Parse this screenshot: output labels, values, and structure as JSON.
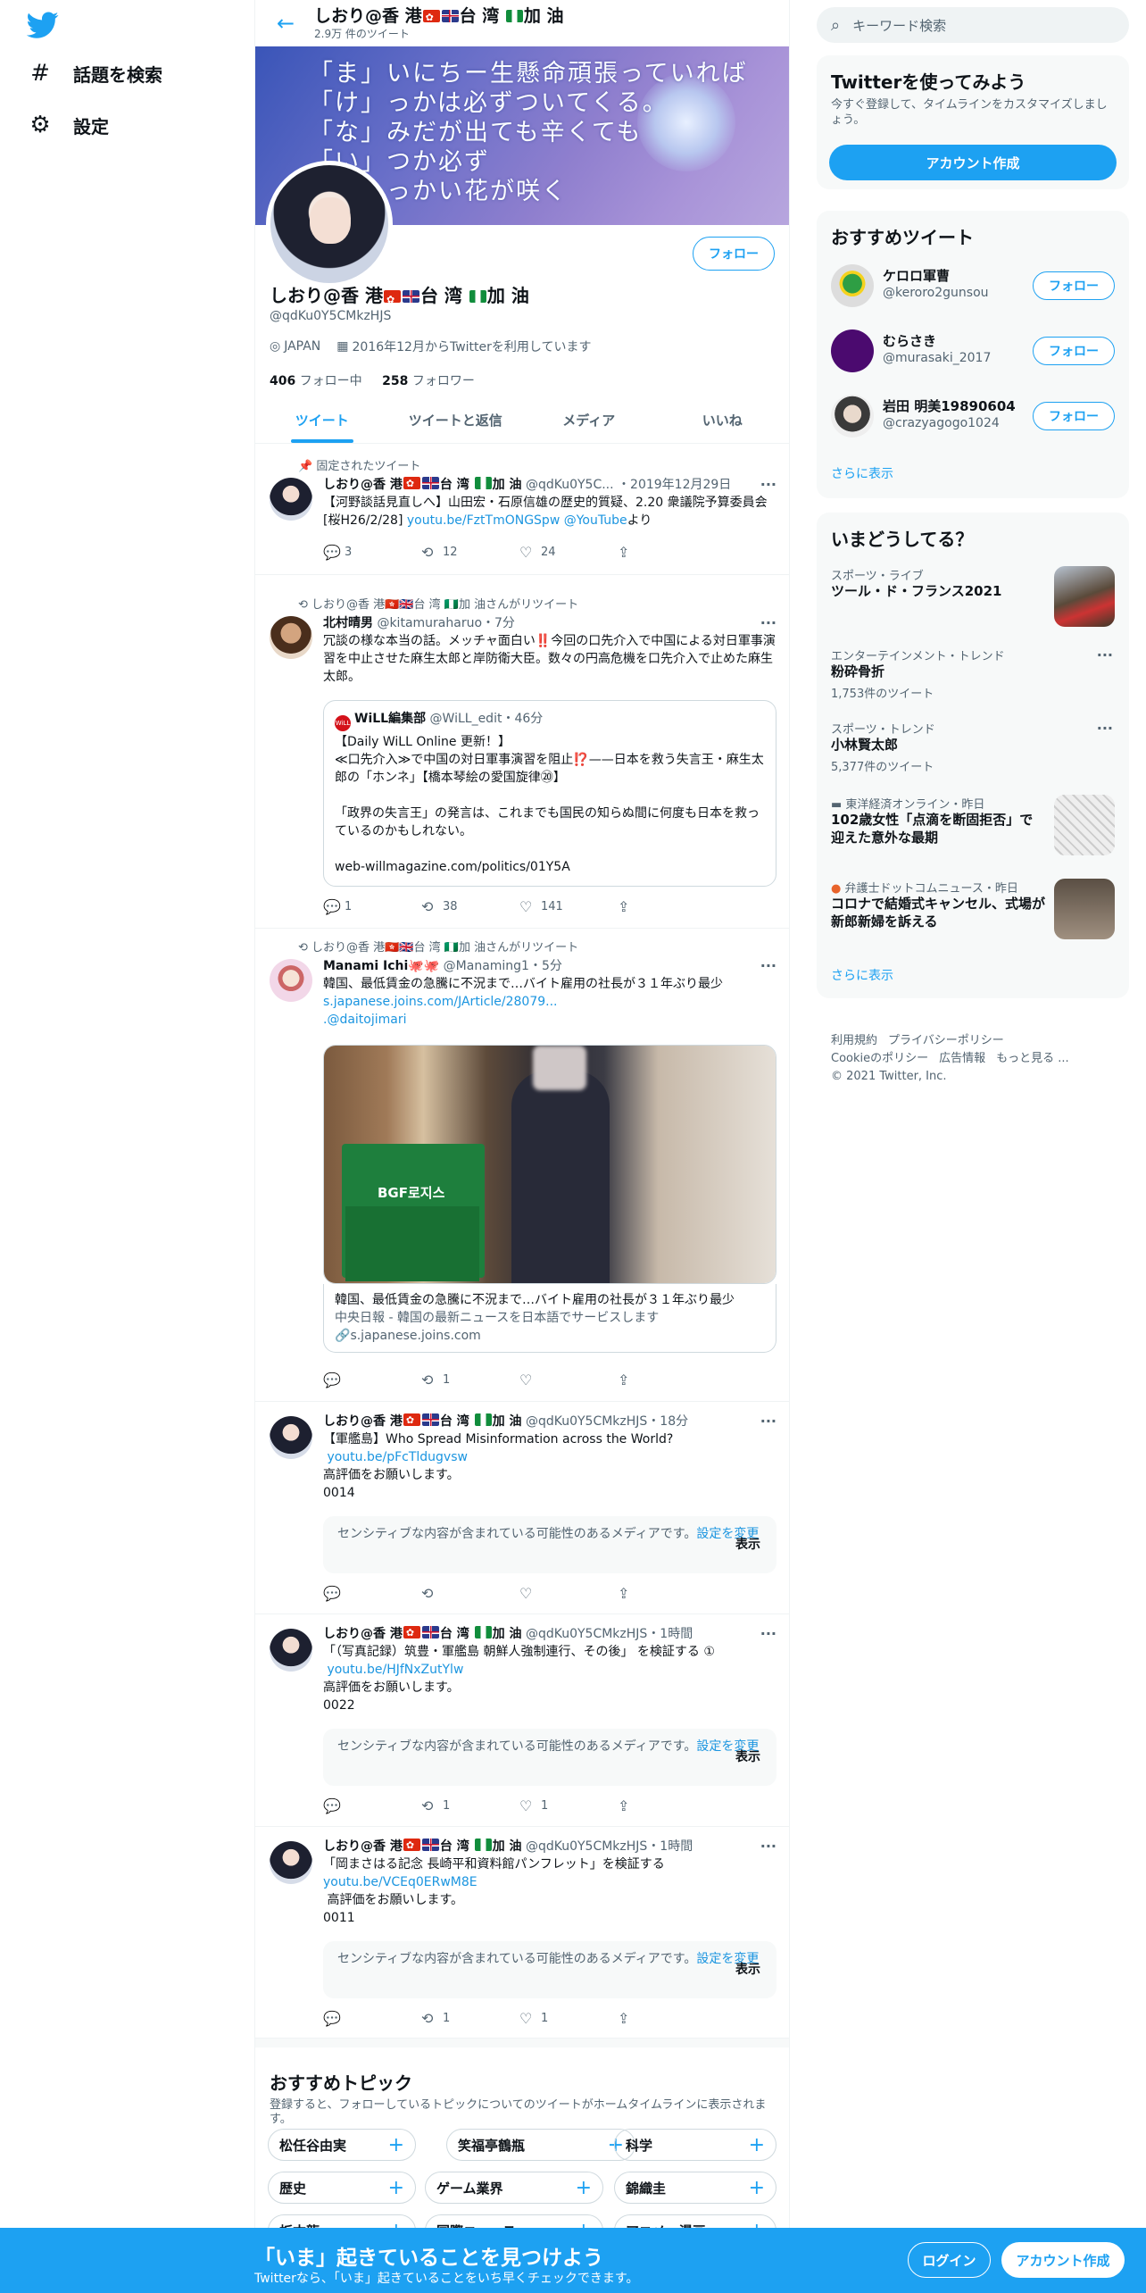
{
  "nav": {
    "items": [
      {
        "label": "話題を検索",
        "icon": "hashtag-icon"
      },
      {
        "label": "設定",
        "icon": "gear-icon"
      }
    ]
  },
  "header": {
    "name": "しおり@香 港🇭🇰🇬🇧台 湾 🇳🇬加 油",
    "count": "2.9万 件のツイート"
  },
  "banner": {
    "poem": "「ま」いにちー生懸命頑張っていれば\n「け」っかは必ずついてくる。\n「な」みだが出ても辛くても\n「い」つか必ず\n「き」っかい花が咲く"
  },
  "profile": {
    "name_pre": "しおり@香 港",
    "name_mid": "台 湾 ",
    "name_post": "加 油",
    "handle": "@qdKu0Y5CMkzHJS",
    "location": "JAPAN",
    "joined": "2016年12月からTwitterを利用しています",
    "following_count": "406",
    "following_label": "フォロー中",
    "followers_count": "258",
    "followers_label": "フォロワー",
    "follow_label": "フォロー"
  },
  "tabs": [
    "ツイート",
    "ツイートと返信",
    "メディア",
    "いいね"
  ],
  "tweets": {
    "t1": {
      "context": "固定されたツイート",
      "name_pre": "しおり@香 港",
      "name_mid": "台 湾 ",
      "name_post": "加 油",
      "handle": "@qdKu0Y5C...",
      "time": "・2019年12月29日",
      "text": "【河野談話見直しへ】山田宏・石原信雄の歴史的質疑、2.20 衆議院予算委員会[桜H26/2/28] ",
      "link1": "youtu.be/FztTmONGSpw",
      "link2": "@YouTube",
      "text_end": "より",
      "replies": "3",
      "retweets": "12",
      "likes": "24"
    },
    "t2": {
      "context": "しおり@香 港🇭🇰🇬🇧台 湾 🇳🇬加 油さんがリツイート",
      "name": "北村晴男",
      "handle": "@kitamuraharuo",
      "time": "・7分",
      "text": "冗談の様な本当の話。メッチャ面白い‼️今回の口先介入で中国による対日軍事演習を中止させた麻生太郎と岸防衛大臣。数々の円高危機を口先介入で止めた麻生太郎。",
      "q_logo": "WiLL",
      "q_name": "WiLL編集部",
      "q_handle": "@WiLL_edit",
      "q_time": "・46分",
      "q_text": "【Daily WiLL Online 更新！】\n≪口先介入≫で中国の対日軍事演習を阻止⁉️——日本を救う失言王・麻生太郎の「ホンネ」【橋本琴絵の愛国旋律⑳】\n\n「政界の失言王」の発言は、これまでも国民の知らぬ間に何度も日本を救っているのかもしれない。\n\nweb-willmagazine.com/politics/01Y5A",
      "replies": "1",
      "retweets": "38",
      "likes": "141"
    },
    "t3": {
      "context": "しおり@香 港🇭🇰🇬🇧台 湾 🇳🇬加 油さんがリツイート",
      "name": "Manami Ichi🐙🐙",
      "handle": "@Manaming1",
      "time": "・5分",
      "text": "韓国、最低賃金の急騰に不況まで…バイト雇用の社長が３１年ぶり最少",
      "link1": "s.japanese.joins.com/JArticle/28079...",
      "link2": ".@daitojimari",
      "crate_label": "BGF로지스",
      "card_title": "韓国、最低賃金の急騰に不況まで…バイト雇用の社長が３１年ぶり最少",
      "card_desc": "中央日報 - 韓国の最新ニュースを日本語でサービスします",
      "card_domain": "s.japanese.joins.com",
      "retweets": "1"
    },
    "t4": {
      "name_pre": "しおり@香 港",
      "name_mid": "台 湾 ",
      "name_post": "加 油",
      "handle": "@qdKu0Y5CMkzHJS",
      "time": "・18分",
      "text1": "【軍艦島】Who Spread Misinformation across the World?",
      "link": "youtu.be/pFcTldugvsw",
      "text2": "高評価をお願いします。\n0014"
    },
    "t5": {
      "name_pre": "しおり@香 港",
      "name_mid": "台 湾 ",
      "name_post": "加 油",
      "handle": "@qdKu0Y5CMkzHJS",
      "time": "・1時間",
      "text1": "「（写真記録）筑豊・軍艦島 朝鮮人強制連行、その後」 を検証する ①",
      "link": "youtu.be/HJfNxZutYlw",
      "text2": "高評価をお願いします。\n0022",
      "retweets": "1",
      "likes": "1"
    },
    "t6": {
      "name_pre": "しおり@香 港",
      "name_mid": "台 湾 ",
      "name_post": "加 油",
      "handle": "@qdKu0Y5CMkzHJS",
      "time": "・1時間",
      "text1": "「岡まさはる記念 長崎平和資料館パンフレット」を検証する",
      "link": "youtu.be/VCEq0ERwM8E",
      "text2": " 高評価をお願いします。\n0011",
      "retweets": "1",
      "likes": "1"
    }
  },
  "sensitive": {
    "text": "センシティブな内容が含まれている可能性のあるメディアです。",
    "link": "設定を変更",
    "show": "表示"
  },
  "topics": {
    "title": "おすすめトピック",
    "sub": "登録すると、フォローしているトピックについてのツイートがホームタイムラインに表示されます。",
    "items": [
      "松任谷由実",
      "笑福亭鶴瓶",
      "科学",
      "歴史",
      "ゲーム業界",
      "錦織圭",
      "板本龍",
      "国際ニュース",
      "アニメ・漫画"
    ]
  },
  "right": {
    "search_placeholder": "キーワード検索",
    "signup_card": {
      "title": "Twitterを使ってみよう",
      "sub": "今すぐ登録して、タイムラインをカスタマイズしましょう。",
      "button": "アカウント作成"
    },
    "suggest": {
      "title": "おすすめツイート",
      "more": "さらに表示",
      "follow": "フォロー",
      "users": [
        {
          "name": "ケロロ軍曹",
          "handle": "@keroro2gunsou"
        },
        {
          "name": "むらさき",
          "handle": "@murasaki_2017"
        },
        {
          "name": "岩田 明美19890604",
          "handle": "@crazyagogo1024"
        }
      ]
    },
    "trends": {
      "title": "いまどうしてる？",
      "more": "さらに表示",
      "items": [
        {
          "cat": "スポーツ・ライブ",
          "title": "ツール・ド・フランス2021",
          "count": ""
        },
        {
          "cat": "エンターテインメント・トレンド",
          "title": "粉砕骨折",
          "count": "1,753件のツイート"
        },
        {
          "cat": "スポーツ・トレンド",
          "title": "小林賢太郎",
          "count": "5,377件のツイート"
        },
        {
          "cat": "東洋経済オンライン・昨日",
          "title": "102歳女性「点滴を断固拒否」で迎えた意外な最期",
          "count": ""
        },
        {
          "cat": "弁護士ドットコムニュース・昨日",
          "title": "コロナで結婚式キャンセル、式場が新郎新婦を訴える",
          "count": ""
        }
      ]
    },
    "footer": {
      "links": [
        "利用規約",
        "プライバシーポリシー",
        "Cookieのポリシー",
        "広告情報",
        "もっと見る ..."
      ],
      "copyright": "© 2021 Twitter, Inc."
    }
  },
  "bottombar": {
    "title": "「いま」起きていることを見つけよう",
    "sub": "Twitterなら、「いま」起きていることをいち早くチェックできます。",
    "login": "ログイン",
    "signup": "アカウント作成"
  },
  "colors": {
    "accent": "#1da1f2",
    "text": "#0f1419",
    "muted": "#536471"
  }
}
